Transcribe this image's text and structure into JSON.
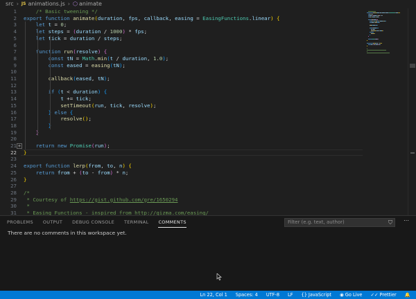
{
  "breadcrumb": {
    "folder": "src",
    "file_badge": "JS",
    "file": "animations.js",
    "symbol": "animate"
  },
  "editor": {
    "active_line": "22",
    "lines": [
      {
        "n": "1",
        "indent": 1,
        "tokens": [
          [
            "cmt",
            "/* Basic tweening */"
          ]
        ]
      },
      {
        "n": "2",
        "indent": 0,
        "tokens": [
          [
            "kw",
            "export "
          ],
          [
            "kw",
            "function "
          ],
          [
            "fn",
            "animate"
          ],
          [
            "bracket",
            "("
          ],
          [
            "var",
            "duration"
          ],
          [
            "",
            ", "
          ],
          [
            "var",
            "fps"
          ],
          [
            "",
            ", "
          ],
          [
            "var",
            "callback"
          ],
          [
            "",
            ", "
          ],
          [
            "var",
            "easing"
          ],
          [
            "",
            " = "
          ],
          [
            "cls",
            "EasingFunctions"
          ],
          [
            "",
            "."
          ],
          [
            "var",
            "linear"
          ],
          [
            "bracket",
            ")"
          ],
          [
            "",
            " "
          ],
          [
            "bracket",
            "{"
          ]
        ]
      },
      {
        "n": "3",
        "indent": 1,
        "tokens": [
          [
            "kw",
            "let "
          ],
          [
            "var",
            "t"
          ],
          [
            "",
            " = "
          ],
          [
            "num",
            "0"
          ],
          [
            "",
            ";"
          ]
        ]
      },
      {
        "n": "4",
        "indent": 1,
        "tokens": [
          [
            "kw",
            "let "
          ],
          [
            "var",
            "steps"
          ],
          [
            "",
            " = "
          ],
          [
            "bracket2",
            "("
          ],
          [
            "var",
            "duration"
          ],
          [
            "",
            " / "
          ],
          [
            "num",
            "1000"
          ],
          [
            "bracket2",
            ")"
          ],
          [
            "",
            " * "
          ],
          [
            "var",
            "fps"
          ],
          [
            "",
            ";"
          ]
        ]
      },
      {
        "n": "5",
        "indent": 1,
        "tokens": [
          [
            "kw",
            "let "
          ],
          [
            "var",
            "tick"
          ],
          [
            "",
            " = "
          ],
          [
            "var",
            "duration"
          ],
          [
            "",
            " / "
          ],
          [
            "var",
            "steps"
          ],
          [
            "",
            ";"
          ]
        ]
      },
      {
        "n": "6",
        "indent": 0,
        "tokens": []
      },
      {
        "n": "7",
        "indent": 1,
        "tokens": [
          [
            "kw",
            "function "
          ],
          [
            "fn",
            "run"
          ],
          [
            "bracket2",
            "("
          ],
          [
            "var",
            "resolve"
          ],
          [
            "bracket2",
            ")"
          ],
          [
            "",
            " "
          ],
          [
            "bracket2",
            "{"
          ]
        ]
      },
      {
        "n": "8",
        "indent": 2,
        "tokens": [
          [
            "kw",
            "const "
          ],
          [
            "var",
            "tN"
          ],
          [
            "",
            " = "
          ],
          [
            "cls",
            "Math"
          ],
          [
            "",
            "."
          ],
          [
            "fn",
            "min"
          ],
          [
            "bracket3",
            "("
          ],
          [
            "var",
            "t"
          ],
          [
            "",
            " / "
          ],
          [
            "var",
            "duration"
          ],
          [
            "",
            ", "
          ],
          [
            "num",
            "1.0"
          ],
          [
            "bracket3",
            ")"
          ],
          [
            "",
            ";"
          ]
        ]
      },
      {
        "n": "9",
        "indent": 2,
        "tokens": [
          [
            "kw",
            "const "
          ],
          [
            "var",
            "eased"
          ],
          [
            "",
            " = "
          ],
          [
            "fn",
            "easing"
          ],
          [
            "bracket3",
            "("
          ],
          [
            "var",
            "tN"
          ],
          [
            "bracket3",
            ")"
          ],
          [
            "",
            ";"
          ]
        ]
      },
      {
        "n": "10",
        "indent": 0,
        "tokens": []
      },
      {
        "n": "11",
        "indent": 2,
        "tokens": [
          [
            "fn",
            "callback"
          ],
          [
            "bracket3",
            "("
          ],
          [
            "var",
            "eased"
          ],
          [
            "",
            ", "
          ],
          [
            "var",
            "tN"
          ],
          [
            "bracket3",
            ")"
          ],
          [
            "",
            ";"
          ]
        ]
      },
      {
        "n": "12",
        "indent": 0,
        "tokens": []
      },
      {
        "n": "13",
        "indent": 2,
        "tokens": [
          [
            "kw",
            "if "
          ],
          [
            "bracket3",
            "("
          ],
          [
            "var",
            "t"
          ],
          [
            "",
            " < "
          ],
          [
            "var",
            "duration"
          ],
          [
            "bracket3",
            ")"
          ],
          [
            "",
            " "
          ],
          [
            "bracket3",
            "{"
          ]
        ]
      },
      {
        "n": "14",
        "indent": 3,
        "tokens": [
          [
            "var",
            "t"
          ],
          [
            "",
            " += "
          ],
          [
            "var",
            "tick"
          ],
          [
            "",
            ";"
          ]
        ]
      },
      {
        "n": "15",
        "indent": 3,
        "tokens": [
          [
            "fn",
            "setTimeout"
          ],
          [
            "bracket",
            "("
          ],
          [
            "var",
            "run"
          ],
          [
            "",
            ", "
          ],
          [
            "var",
            "tick"
          ],
          [
            "",
            ", "
          ],
          [
            "var",
            "resolve"
          ],
          [
            "bracket",
            ")"
          ],
          [
            "",
            ";"
          ]
        ]
      },
      {
        "n": "16",
        "indent": 2,
        "tokens": [
          [
            "bracket3",
            "}"
          ],
          [
            "",
            " "
          ],
          [
            "kw",
            "else "
          ],
          [
            "bracket3",
            "{"
          ]
        ]
      },
      {
        "n": "17",
        "indent": 3,
        "tokens": [
          [
            "fn",
            "resolve"
          ],
          [
            "bracket",
            "()"
          ],
          [
            "",
            ";"
          ]
        ]
      },
      {
        "n": "18",
        "indent": 2,
        "tokens": [
          [
            "bracket3",
            "}"
          ]
        ]
      },
      {
        "n": "19",
        "indent": 1,
        "tokens": [
          [
            "bracket2",
            "}"
          ]
        ]
      },
      {
        "n": "20",
        "indent": 0,
        "tokens": []
      },
      {
        "n": "21",
        "indent": 1,
        "tokens": [
          [
            "kw",
            "return "
          ],
          [
            "kw",
            "new "
          ],
          [
            "cls",
            "Promise"
          ],
          [
            "bracket2",
            "("
          ],
          [
            "var",
            "run"
          ],
          [
            "bracket2",
            ")"
          ],
          [
            "",
            ";"
          ]
        ]
      },
      {
        "n": "22",
        "indent": 0,
        "tokens": [
          [
            "bracket",
            "}"
          ]
        ]
      },
      {
        "n": "23",
        "indent": 0,
        "tokens": []
      },
      {
        "n": "24",
        "indent": 0,
        "tokens": [
          [
            "kw",
            "export "
          ],
          [
            "kw",
            "function "
          ],
          [
            "fn",
            "lerp"
          ],
          [
            "bracket",
            "("
          ],
          [
            "var",
            "from"
          ],
          [
            "",
            ", "
          ],
          [
            "var",
            "to"
          ],
          [
            "",
            ", "
          ],
          [
            "var",
            "n"
          ],
          [
            "bracket",
            ")"
          ],
          [
            "",
            " "
          ],
          [
            "bracket",
            "{"
          ]
        ]
      },
      {
        "n": "25",
        "indent": 1,
        "tokens": [
          [
            "kw",
            "return "
          ],
          [
            "var",
            "from"
          ],
          [
            "",
            " + "
          ],
          [
            "bracket2",
            "("
          ],
          [
            "var",
            "to"
          ],
          [
            "",
            " - "
          ],
          [
            "var",
            "from"
          ],
          [
            "bracket2",
            ")"
          ],
          [
            "",
            " * "
          ],
          [
            "var",
            "n"
          ],
          [
            "",
            ";"
          ]
        ]
      },
      {
        "n": "26",
        "indent": 0,
        "tokens": [
          [
            "bracket",
            "}"
          ]
        ]
      },
      {
        "n": "27",
        "indent": 0,
        "tokens": []
      },
      {
        "n": "28",
        "indent": 0,
        "tokens": [
          [
            "cmt",
            "/*"
          ]
        ]
      },
      {
        "n": "29",
        "indent": 0,
        "tokens": [
          [
            "cmt",
            " * Courtesy of "
          ],
          [
            "link",
            "https://gist.github.com/gre/1650294"
          ]
        ]
      },
      {
        "n": "30",
        "indent": 0,
        "tokens": [
          [
            "cmt",
            " *"
          ]
        ]
      },
      {
        "n": "31",
        "indent": 0,
        "tokens": [
          [
            "cmt",
            " * Easing Functions - inspired from http://gizma.com/easing/"
          ]
        ]
      }
    ]
  },
  "panel": {
    "tabs": [
      "PROBLEMS",
      "OUTPUT",
      "DEBUG CONSOLE",
      "TERMINAL",
      "COMMENTS"
    ],
    "active_tab": 4,
    "filter_placeholder": "Filter (e.g. text, author)",
    "message": "There are no comments in this workspace yet."
  },
  "statusbar": {
    "position": "Ln 22, Col 1",
    "spaces": "Spaces: 4",
    "encoding": "UTF-8",
    "eol": "LF",
    "language": "JavaScript",
    "golive": "Go Live",
    "prettier": "Prettier"
  },
  "colors": {
    "editor_bg": "#1f1f1f",
    "statusbar_bg": "#0078d4",
    "keyword": "#569cd6",
    "function": "#dcdcaa",
    "variable": "#9cdcfe",
    "comment": "#6a9955"
  }
}
